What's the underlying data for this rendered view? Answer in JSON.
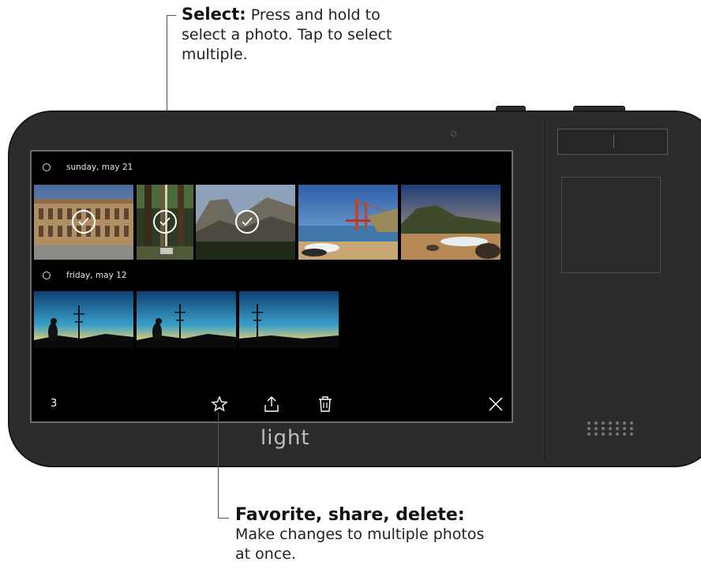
{
  "callouts": {
    "select": {
      "lead": "Select:",
      "rest": " Press and hold to select a photo. Tap to select multiple."
    },
    "actions": {
      "lead": "Favorite, share, delete:",
      "rest": "Make changes to multiple photos at once."
    }
  },
  "screen": {
    "groups": [
      {
        "date_label": "sunday, may 21",
        "photo_count": 5,
        "selected_count": 3
      },
      {
        "date_label": "friday, may 12",
        "photo_count": 3,
        "selected_count": 0
      }
    ],
    "bottom_bar": {
      "selected_count": "3",
      "icons": [
        "star-icon",
        "share-icon",
        "trash-icon",
        "close-icon"
      ]
    }
  },
  "device": {
    "brand": "light",
    "colors": {
      "body": "#2c2c2c",
      "screen": "#000000",
      "accent_check": "#ffffff"
    }
  }
}
